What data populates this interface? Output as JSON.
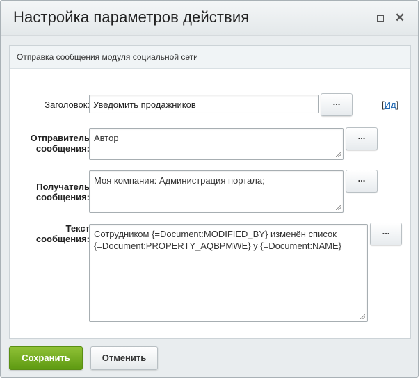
{
  "dialog": {
    "title": "Настройка параметров действия",
    "section_title": "Отправка сообщения модуля социальной сети"
  },
  "fields": {
    "subject": {
      "label": "Заголовок:",
      "value": "Уведомить продажников",
      "button": "...",
      "link_bracket_open": "[",
      "link_text": "Ид",
      "link_bracket_close": "]"
    },
    "sender": {
      "label_line1": "Отправитель",
      "label_line2": "сообщения:",
      "value": "Автор",
      "button": "..."
    },
    "recipient": {
      "label_line1": "Получатель",
      "label_line2": "сообщения:",
      "value": "Моя компания: Администрация портала;",
      "button": "..."
    },
    "message": {
      "label_line1": "Текст",
      "label_line2": "сообщения:",
      "value_line1": "Сотрудником {=Document:MODIFIED_BY} изменён список",
      "value_line2": "{=Document:PROPERTY_AQBPMWE} у {=Document:NAME}",
      "button": "..."
    }
  },
  "footer": {
    "save_label": "Сохранить",
    "cancel_label": "Отменить"
  },
  "icons": {
    "maximize": "maximize-icon",
    "close": "close-icon",
    "resize": "resize-grip-icon"
  },
  "colors": {
    "save_button": "#6ea61f",
    "link": "#2067b0",
    "titlebar": "#e9edef"
  }
}
